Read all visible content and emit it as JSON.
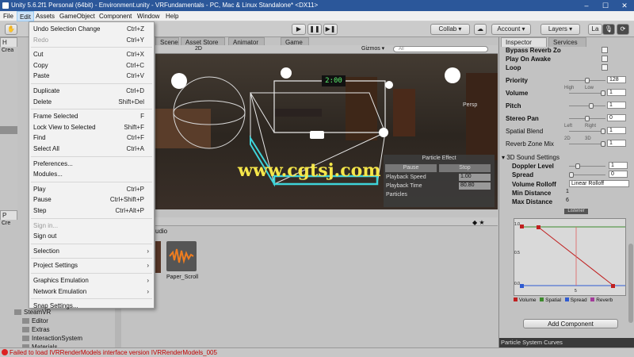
{
  "window": {
    "title": "Unity 5.6.2f1 Personal (64bit) - Environment.unity - VRFundamentals - PC, Mac & Linux Standalone* <DX11>"
  },
  "menubar": {
    "items": [
      "File",
      "Edit",
      "Assets",
      "GameObject",
      "Component",
      "Window",
      "Help"
    ]
  },
  "toolbar": {
    "collab": "Collab ▾",
    "account": "Account ▾",
    "layers": "Layers ▾",
    "layout": "La"
  },
  "tabs": {
    "scene": "Scene",
    "asset_store": "Asset Store",
    "animator": "Animator",
    "game": "Game",
    "inspector": "Inspector",
    "services": "Services"
  },
  "scene": {
    "shading": "2D",
    "gizmos": "Gizmos ▾",
    "search": "All",
    "persp": "Persp",
    "clock": "2:00",
    "particle": {
      "title": "Particle Effect",
      "pause": "Pause",
      "stop": "Stop",
      "speed_label": "Playback Speed",
      "speed": "1.00",
      "time_label": "Playback Time",
      "time": "80.80",
      "particles_label": "Particles"
    }
  },
  "watermark": "www.cgtsj.com",
  "edit_menu": [
    {
      "label": "Undo Selection Change",
      "shortcut": "Ctrl+Z"
    },
    {
      "label": "Redo",
      "shortcut": "Ctrl+Y",
      "disabled": true
    },
    {
      "sep": true
    },
    {
      "label": "Cut",
      "shortcut": "Ctrl+X"
    },
    {
      "label": "Copy",
      "shortcut": "Ctrl+C"
    },
    {
      "label": "Paste",
      "shortcut": "Ctrl+V"
    },
    {
      "sep": true
    },
    {
      "label": "Duplicate",
      "shortcut": "Ctrl+D"
    },
    {
      "label": "Delete",
      "shortcut": "Shift+Del"
    },
    {
      "sep": true
    },
    {
      "label": "Frame Selected",
      "shortcut": "F"
    },
    {
      "label": "Lock View to Selected",
      "shortcut": "Shift+F"
    },
    {
      "label": "Find",
      "shortcut": "Ctrl+F"
    },
    {
      "label": "Select All",
      "shortcut": "Ctrl+A"
    },
    {
      "sep": true
    },
    {
      "label": "Preferences..."
    },
    {
      "label": "Modules..."
    },
    {
      "sep": true
    },
    {
      "label": "Play",
      "shortcut": "Ctrl+P"
    },
    {
      "label": "Pause",
      "shortcut": "Ctrl+Shift+P"
    },
    {
      "label": "Step",
      "shortcut": "Ctrl+Alt+P"
    },
    {
      "sep": true
    },
    {
      "label": "Sign in...",
      "disabled": true
    },
    {
      "label": "Sign out"
    },
    {
      "sep": true
    },
    {
      "label": "Selection",
      "submenu": true
    },
    {
      "sep": true
    },
    {
      "label": "Project Settings",
      "submenu": true
    },
    {
      "sep": true
    },
    {
      "label": "Graphics Emulation",
      "submenu": true
    },
    {
      "label": "Network Emulation",
      "submenu": true
    },
    {
      "sep": true
    },
    {
      "label": "Snap Settings..."
    }
  ],
  "inspector": {
    "rows": [
      {
        "label": "Bypass Reverb Zo",
        "type": "check"
      },
      {
        "label": "Play On Awake",
        "type": "check"
      },
      {
        "label": "Loop",
        "type": "check"
      },
      {
        "label": "Priority",
        "value": "128",
        "slider": 0.5,
        "left": "High",
        "right": "Low"
      },
      {
        "label": "Volume",
        "value": "1",
        "slider": 1.0
      },
      {
        "label": "Pitch",
        "value": "1",
        "slider": 0.62
      },
      {
        "label": "Stereo Pan",
        "value": "0",
        "slider": 0.5,
        "left": "Left",
        "right": "Right"
      },
      {
        "label": "Spatial Blend",
        "value": "1",
        "slider": 1.0,
        "left": "2D",
        "right": "3D"
      },
      {
        "label": "Reverb Zone Mix",
        "value": "1",
        "slider": 1.0
      }
    ],
    "sound_settings_title": "3D Sound Settings",
    "sound_rows": [
      {
        "label": "Doppler Level",
        "value": "1",
        "slider": 0.2
      },
      {
        "label": "Spread",
        "value": "0",
        "slider": 0.0
      },
      {
        "label": "Volume Rolloff",
        "value": "Linear Rolloff"
      },
      {
        "label": "Min Distance",
        "value": "1"
      },
      {
        "label": "Max Distance",
        "value": "6"
      }
    ],
    "listener": "Listener",
    "curve_ticks": {
      "y_top": "1.0",
      "y_mid": "0.5",
      "y_bot": "0.0",
      "x_mid": "5"
    },
    "legend": [
      "Volume",
      "Spatial",
      "Spread",
      "Reverb"
    ],
    "legend_colors": [
      "#c02020",
      "#3d8a2d",
      "#2f5bd1",
      "#a33a9a"
    ],
    "add_component": "Add Component",
    "particle_curves": "Particle System Curves"
  },
  "project": {
    "header": "udio",
    "assets": [
      {
        "label": "ll"
      },
      {
        "label": "Paper_Scroll"
      }
    ]
  },
  "hierarchy_labels": {
    "h": "H",
    "create": "Crea",
    "p": "P",
    "create2": "Cre"
  },
  "tree": [
    {
      "label": "SteamVR",
      "indent": 0
    },
    {
      "label": "Editor",
      "indent": 1
    },
    {
      "label": "Extras",
      "indent": 1
    },
    {
      "label": "InteractionSystem",
      "indent": 1
    },
    {
      "label": "Materials",
      "indent": 1
    }
  ],
  "status": "Failed to load IVRRenderModels interface version IVRRenderModels_005"
}
